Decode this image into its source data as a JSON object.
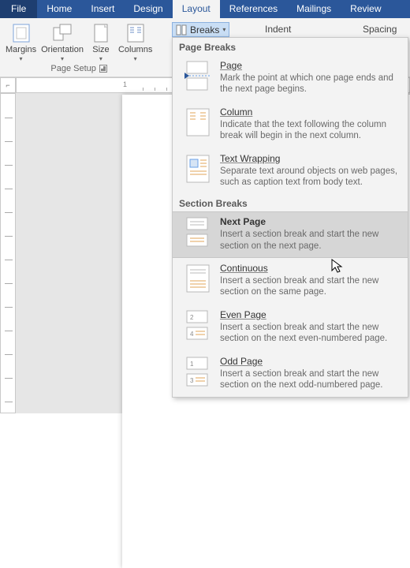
{
  "tabs": {
    "file": "File",
    "home": "Home",
    "insert": "Insert",
    "design": "Design",
    "layout": "Layout",
    "references": "References",
    "mailings": "Mailings",
    "review": "Review"
  },
  "ribbon": {
    "margins": "Margins",
    "orientation": "Orientation",
    "size": "Size",
    "columns": "Columns",
    "group_label": "Page Setup",
    "breaks": "Breaks",
    "indent": "Indent",
    "spacing": "Spacing"
  },
  "gallery": {
    "section1": "Page Breaks",
    "section2": "Section Breaks",
    "items": [
      {
        "title": "Page",
        "desc": "Mark the point at which one page ends and the next page begins."
      },
      {
        "title": "Column",
        "desc": "Indicate that the text following the column break will begin in the next column."
      },
      {
        "title": "Text Wrapping",
        "desc": "Separate text around objects on web pages, such as caption text from body text."
      },
      {
        "title": "Next Page",
        "desc": "Insert a section break and start the new section on the next page."
      },
      {
        "title": "Continuous",
        "desc": "Insert a section break and start the new section on the same page."
      },
      {
        "title": "Even Page",
        "desc": "Insert a section break and start the new section on the next even-numbered page."
      },
      {
        "title": "Odd Page",
        "desc": "Insert a section break and start the new section on the next odd-numbered page."
      }
    ]
  },
  "ruler": {
    "label": "1"
  }
}
